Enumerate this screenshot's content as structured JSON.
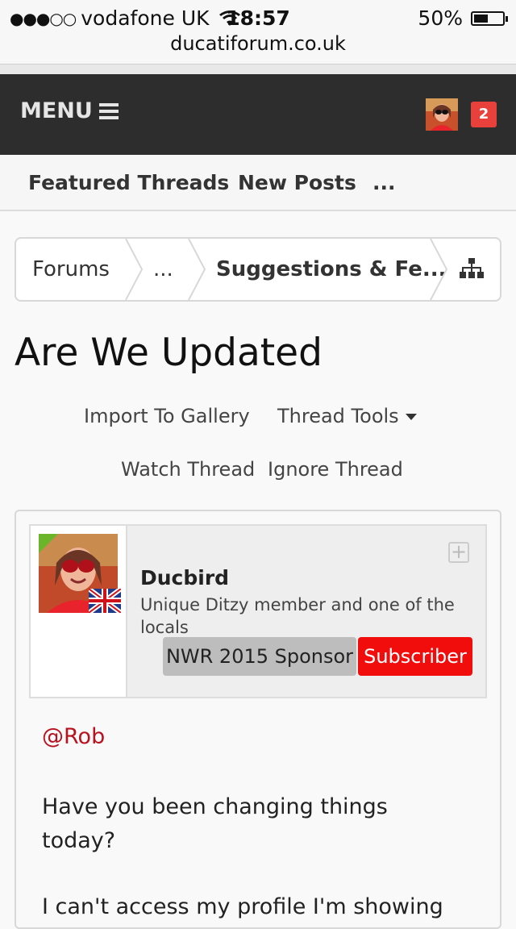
{
  "status_bar": {
    "signal": "●●●○○",
    "carrier": "vodafone UK",
    "time": "18:57",
    "battery": "50%",
    "battery_level": 0.5,
    "url": "ducatiforum.co.uk"
  },
  "header": {
    "menu_label": "MENU",
    "notification_count": "2",
    "badge_color": "#e8403a"
  },
  "tabs": [
    "Featured Threads",
    "New Posts",
    "..."
  ],
  "breadcrumb": [
    "Forums",
    "...",
    "Suggestions & Fe..."
  ],
  "thread": {
    "title": "Are We Updated",
    "actions": {
      "import": "Import To Gallery",
      "tools": "Thread Tools",
      "watch": "Watch Thread",
      "ignore": "Ignore Thread"
    }
  },
  "post": {
    "username": "Ducbird",
    "user_title": "Unique Ditzy member and one of the locals",
    "banners": [
      "NWR 2015 Sponsor",
      "Subscriber"
    ],
    "mention": "@Rob",
    "paragraphs": [
      "Have you been changing things today?",
      "I can't access my profile I'm showing"
    ],
    "mention_color": "#b8121f",
    "subscriber_color": "#f20d0d"
  }
}
